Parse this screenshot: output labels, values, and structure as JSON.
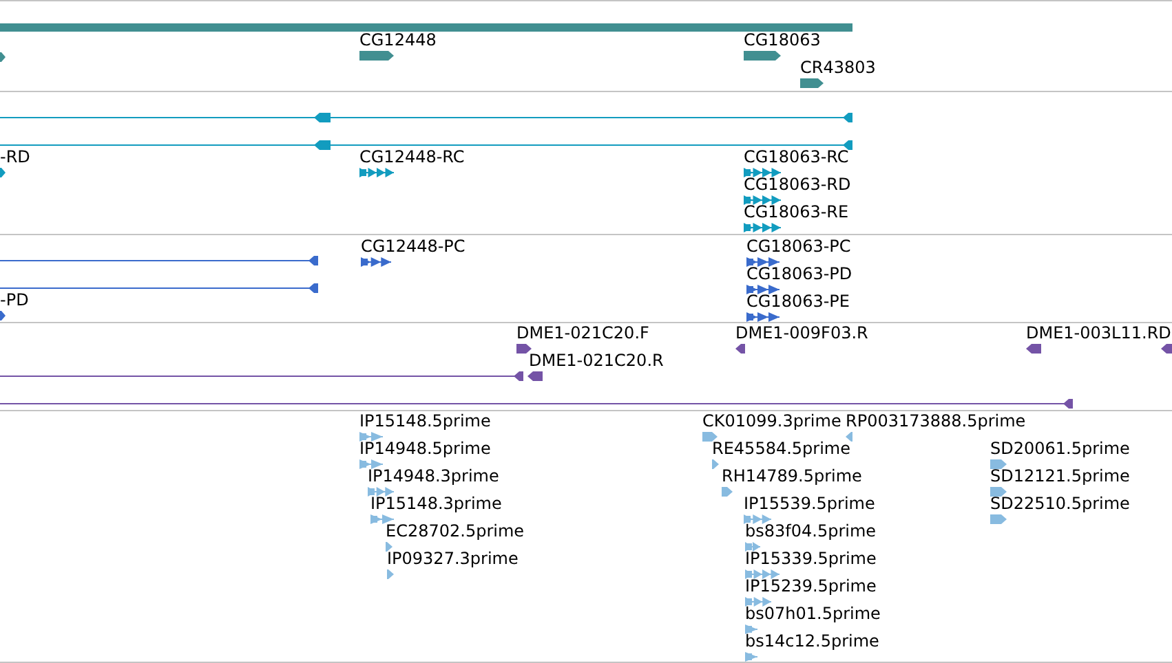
{
  "tracks": [
    {
      "kind": "genes",
      "color": "#418f91",
      "features": [
        {
          "label": "CG12448"
        },
        {
          "label": "CG18063"
        },
        {
          "label": "CR43803"
        }
      ]
    },
    {
      "kind": "transcripts",
      "color": "#129cbf",
      "features": [
        {
          "label": "-RD"
        },
        {
          "label": "CG12448-RC"
        },
        {
          "label": "CG18063-RC"
        },
        {
          "label": "CG18063-RD"
        },
        {
          "label": "CG18063-RE"
        }
      ]
    },
    {
      "kind": "proteins",
      "color": "#3a6bcc",
      "features": [
        {
          "label": "CG12448-PC"
        },
        {
          "label": "-PD"
        },
        {
          "label": "CG18063-PC"
        },
        {
          "label": "CG18063-PD"
        },
        {
          "label": "CG18063-PE"
        }
      ]
    },
    {
      "kind": "clones",
      "color": "#7453a6",
      "features": [
        {
          "label": "DME1-021C20.F"
        },
        {
          "label": "DME1-021C20.R"
        },
        {
          "label": "DME1-009F03.R"
        },
        {
          "label": "DME1-003L11.RD"
        }
      ]
    },
    {
      "kind": "ests",
      "color": "#88bbe0",
      "features": [
        {
          "label": "IP15148.5prime"
        },
        {
          "label": "IP14948.5prime"
        },
        {
          "label": "IP14948.3prime"
        },
        {
          "label": "IP15148.3prime"
        },
        {
          "label": "EC28702.5prime"
        },
        {
          "label": "IP09327.3prime"
        },
        {
          "label": "CK01099.3prime"
        },
        {
          "label": "RP003173888.5prime"
        },
        {
          "label": "RE45584.5prime"
        },
        {
          "label": "RH14789.5prime"
        },
        {
          "label": "IP15539.5prime"
        },
        {
          "label": "bs83f04.5prime"
        },
        {
          "label": "IP15339.5prime"
        },
        {
          "label": "IP15239.5prime"
        },
        {
          "label": "bs07h01.5prime"
        },
        {
          "label": "bs14c12.5prime"
        },
        {
          "label": "SD20061.5prime"
        },
        {
          "label": "SD12121.5prime"
        },
        {
          "label": "SD22510.5prime"
        }
      ]
    }
  ]
}
